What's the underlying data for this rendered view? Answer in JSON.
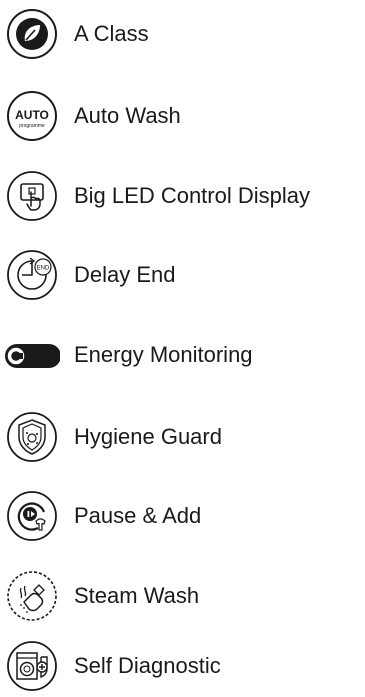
{
  "features": [
    {
      "label": "A Class",
      "icon": "leaf-icon"
    },
    {
      "label": "Auto Wash",
      "icon": "auto-programme-icon",
      "icon_text": [
        "AUTO",
        "programme"
      ]
    },
    {
      "label": "Big LED Control Display",
      "icon": "touch-display-icon"
    },
    {
      "label": "Delay End",
      "icon": "delay-end-icon",
      "icon_text": [
        "END"
      ]
    },
    {
      "label": "Energy Monitoring",
      "icon": "energy-monitoring-icon"
    },
    {
      "label": "Hygiene Guard",
      "icon": "hygiene-shield-icon"
    },
    {
      "label": "Pause & Add",
      "icon": "pause-add-icon"
    },
    {
      "label": "Steam Wash",
      "icon": "steam-wash-icon"
    },
    {
      "label": "Self Diagnostic",
      "icon": "self-diagnostic-icon"
    }
  ]
}
